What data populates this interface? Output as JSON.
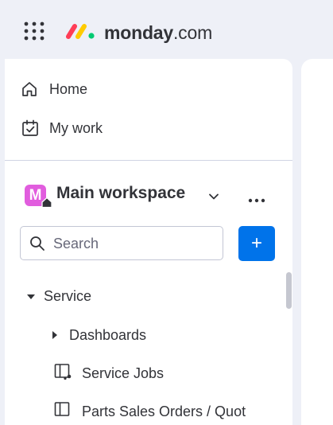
{
  "header": {
    "brand_bold": "monday",
    "brand_suffix": ".com",
    "logo_colors": [
      "#ff3d57",
      "#ffcb00",
      "#00ca72"
    ]
  },
  "nav": {
    "home_label": "Home",
    "my_work_label": "My work"
  },
  "workspace": {
    "avatar_letter": "M",
    "avatar_color": "#e15dde",
    "name": "Main workspace"
  },
  "search": {
    "placeholder": "Search",
    "value": ""
  },
  "add_button_symbol": "+",
  "tree": [
    {
      "label": "Service",
      "icon": "caret-down-icon",
      "expanded": true
    },
    {
      "label": "Dashboards",
      "icon": "caret-right-icon",
      "expanded": false
    },
    {
      "label": "Service Jobs",
      "icon": "board-icon"
    },
    {
      "label": "Parts Sales Orders / Quot",
      "icon": "board-icon"
    }
  ],
  "accent_color": "#0073ea"
}
